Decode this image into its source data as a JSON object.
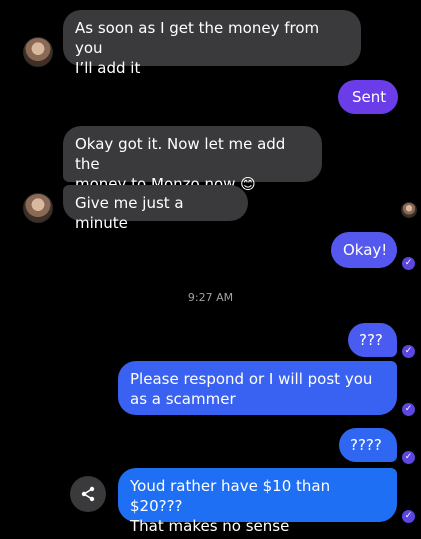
{
  "messages": [
    {
      "id": "m1",
      "direction": "incoming",
      "text": "As soon as I get the money from you\nI’ll add it"
    },
    {
      "id": "m2",
      "direction": "outgoing",
      "text": "Sent"
    },
    {
      "id": "m3",
      "direction": "incoming",
      "text": "Okay got it. Now let me add the\nmoney to Monzo now 😊"
    },
    {
      "id": "m4",
      "direction": "incoming",
      "text": "Give me just a minute"
    },
    {
      "id": "m5",
      "direction": "outgoing",
      "text": "Okay!"
    },
    {
      "id": "m6",
      "direction": "outgoing",
      "text": "???"
    },
    {
      "id": "m7",
      "direction": "outgoing",
      "text": "Please respond or I will post you\nas a scammer"
    },
    {
      "id": "m8",
      "direction": "outgoing",
      "text": "????"
    },
    {
      "id": "m9",
      "direction": "outgoing",
      "text": "Youd rather have $10 than $20???\nThat makes no sense"
    }
  ],
  "timestamp": "9:27 AM",
  "colors": {
    "background": "#000000",
    "incoming_bubble": "#3a3a3c",
    "outgoing_purple": "#6a3de8",
    "outgoing_blue_top": "#4f57f0",
    "outgoing_blue_bottom": "#1f6ff5",
    "read_receipt": "#5b46e0"
  },
  "icons": {
    "avatar": "contact-avatar",
    "read_receipt": "check-circle-icon",
    "share": "share-icon"
  }
}
